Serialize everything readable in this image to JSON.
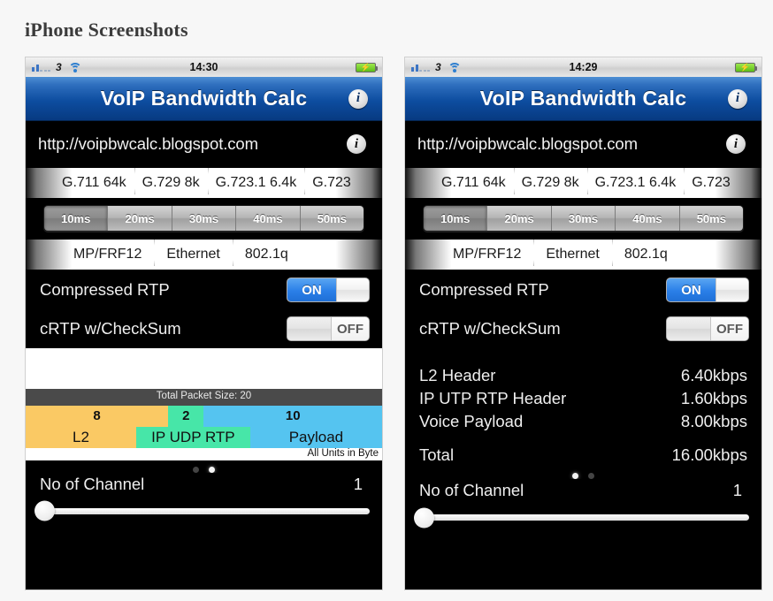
{
  "page": {
    "heading": "iPhone Screenshots"
  },
  "colors": {
    "nav_blue": "#0d4da0",
    "switch_on_blue": "#2a7fe8",
    "packet_l2": "#FAC964",
    "packet_ipudprtp": "#47E6A8",
    "packet_payload": "#55C4F0",
    "packet_header_bar": "#4a4a4a"
  },
  "screens": [
    {
      "id": "screen-left",
      "status_bar": {
        "carrier": "3",
        "signal_icon": "signal-bars-icon",
        "wifi_icon": "wifi-icon",
        "time": "14:30",
        "battery_icon": "battery-charging-icon",
        "battery_bolt": "⚡"
      },
      "nav": {
        "title": "VoIP Bandwidth Calc",
        "info_icon": "info-icon",
        "info_glyph": "i"
      },
      "url_bar": {
        "url": "http://voipbwcalc.blogspot.com",
        "info_icon": "info-icon",
        "info_glyph": "i"
      },
      "codec_picker": {
        "items": [
          "G.711 64k",
          "G.729 8k",
          "G.723.1 6.4k",
          "G.723"
        ]
      },
      "interval_segmented": {
        "options": [
          "10ms",
          "20ms",
          "30ms",
          "40ms",
          "50ms"
        ],
        "selected": "10ms"
      },
      "encap_picker": {
        "items": [
          "MP/FRF12",
          "Ethernet",
          "802.1q"
        ]
      },
      "switches": [
        {
          "label": "Compressed RTP",
          "state": "ON",
          "on_label": "ON"
        },
        {
          "label": "cRTP w/CheckSum",
          "state": "OFF",
          "off_label": "OFF"
        }
      ],
      "packet_viz": {
        "title": "Total Packet Size: 20",
        "segments": [
          {
            "name": "L2",
            "value": "8",
            "width_pct": 40
          },
          {
            "name": "IP UDP RTP",
            "value": "2",
            "width_pct": 10
          },
          {
            "name": "Payload",
            "value": "10",
            "width_pct": 50
          }
        ],
        "label_widths_pct": [
          31,
          32,
          37
        ],
        "units_note": "All Units in Byte"
      },
      "page_dots": {
        "count": 2,
        "active_index": 1
      },
      "channel": {
        "label": "No of Channel",
        "value": "1"
      },
      "slider": {
        "position_pct": 0
      }
    },
    {
      "id": "screen-right",
      "status_bar": {
        "carrier": "3",
        "signal_icon": "signal-bars-icon",
        "wifi_icon": "wifi-icon",
        "time": "14:29",
        "battery_icon": "battery-charging-icon",
        "battery_bolt": "⚡"
      },
      "nav": {
        "title": "VoIP Bandwidth Calc",
        "info_icon": "info-icon",
        "info_glyph": "i"
      },
      "url_bar": {
        "url": "http://voipbwcalc.blogspot.com",
        "info_icon": "info-icon",
        "info_glyph": "i"
      },
      "codec_picker": {
        "items": [
          "G.711 64k",
          "G.729 8k",
          "G.723.1 6.4k",
          "G.723"
        ]
      },
      "interval_segmented": {
        "options": [
          "10ms",
          "20ms",
          "30ms",
          "40ms",
          "50ms"
        ],
        "selected": "10ms"
      },
      "encap_picker": {
        "items": [
          "MP/FRF12",
          "Ethernet",
          "802.1q"
        ]
      },
      "switches": [
        {
          "label": "Compressed RTP",
          "state": "ON",
          "on_label": "ON"
        },
        {
          "label": "cRTP w/CheckSum",
          "state": "OFF",
          "off_label": "OFF"
        }
      ],
      "results": [
        {
          "label": "L2 Header",
          "value": "6.40kbps"
        },
        {
          "label": "IP UTP RTP Header",
          "value": "1.60kbps"
        },
        {
          "label": "Voice Payload",
          "value": "8.00kbps"
        },
        {
          "label": "Total",
          "value": "16.00kbps"
        }
      ],
      "page_dots": {
        "count": 2,
        "active_index": 0
      },
      "channel": {
        "label": "No of Channel",
        "value": "1"
      },
      "slider": {
        "position_pct": 0
      }
    }
  ]
}
